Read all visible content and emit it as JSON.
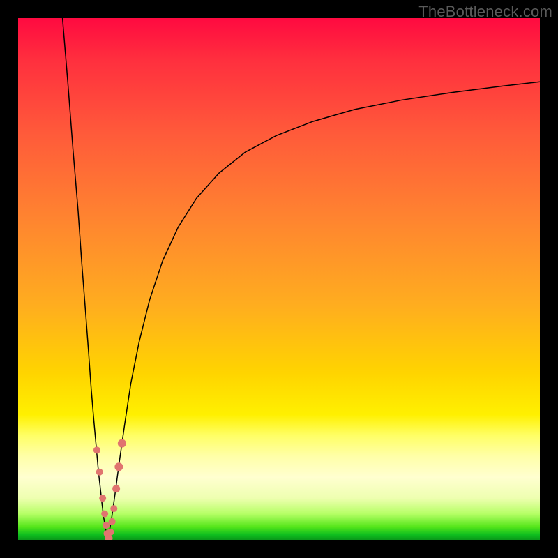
{
  "watermark": "TheBottleneck.com",
  "colors": {
    "curve": "#000000",
    "marker": "#e0746f",
    "frame": "#000000"
  },
  "chart_data": {
    "type": "line",
    "title": "",
    "xlabel": "",
    "ylabel": "",
    "xlim": [
      0,
      100
    ],
    "ylim": [
      0,
      100
    ],
    "grid": false,
    "series": [
      {
        "name": "left-branch",
        "x": [
          8.5,
          9.5,
          10.5,
          11.5,
          12.2,
          12.9,
          13.5,
          14.0,
          14.5,
          15.0,
          15.4,
          15.8,
          16.1,
          16.4,
          16.7,
          16.9,
          17.2
        ],
        "y": [
          100,
          88,
          75,
          63,
          53,
          44,
          36,
          29,
          23,
          17.5,
          13,
          9.5,
          6.7,
          4.3,
          2.5,
          1.2,
          0
        ]
      },
      {
        "name": "right-branch",
        "x": [
          17.2,
          17.9,
          18.6,
          19.4,
          20.4,
          21.6,
          23.2,
          25.2,
          27.7,
          30.7,
          34.2,
          38.5,
          43.5,
          49.5,
          56.5,
          64.5,
          73.5,
          83.5,
          93.0,
          100
        ],
        "y": [
          0,
          4,
          9,
          15,
          22,
          30,
          38,
          46,
          53.5,
          60,
          65.5,
          70.3,
          74.3,
          77.5,
          80.2,
          82.5,
          84.3,
          85.8,
          87.0,
          87.8
        ]
      }
    ],
    "markers": {
      "name": "dots",
      "points": [
        {
          "x": 15.1,
          "y": 17.2,
          "r": 5
        },
        {
          "x": 15.6,
          "y": 13.0,
          "r": 5
        },
        {
          "x": 16.2,
          "y": 8.0,
          "r": 5
        },
        {
          "x": 16.6,
          "y": 5.0,
          "r": 5
        },
        {
          "x": 16.85,
          "y": 2.8,
          "r": 5
        },
        {
          "x": 17.05,
          "y": 1.2,
          "r": 5
        },
        {
          "x": 17.25,
          "y": 0.3,
          "r": 5
        },
        {
          "x": 17.45,
          "y": 0.3,
          "r": 5
        },
        {
          "x": 17.7,
          "y": 1.5,
          "r": 5
        },
        {
          "x": 18.0,
          "y": 3.5,
          "r": 5
        },
        {
          "x": 18.35,
          "y": 6.0,
          "r": 5
        },
        {
          "x": 18.8,
          "y": 9.8,
          "r": 5.5
        },
        {
          "x": 19.3,
          "y": 14.0,
          "r": 6
        },
        {
          "x": 19.9,
          "y": 18.5,
          "r": 6
        }
      ]
    }
  }
}
